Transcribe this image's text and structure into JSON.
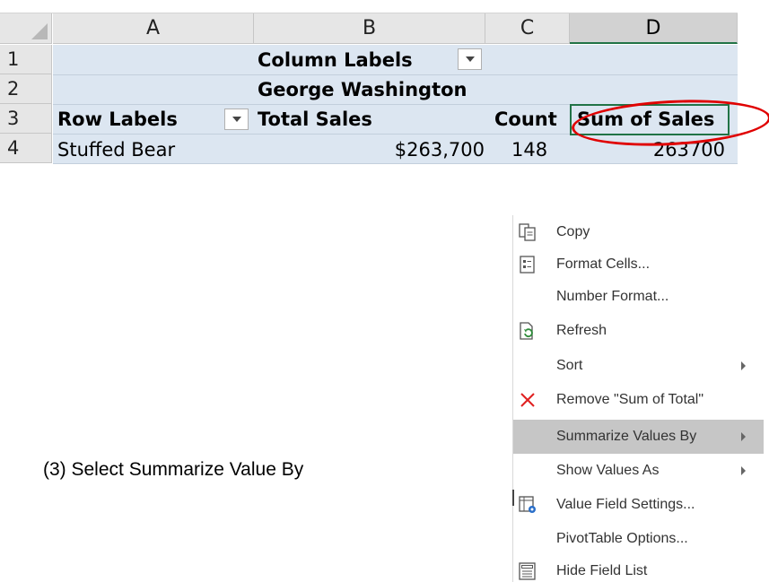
{
  "sheet": {
    "columns": [
      "A",
      "B",
      "C",
      "D"
    ],
    "rows": [
      "1",
      "2",
      "3",
      "4"
    ],
    "cells": {
      "column_labels": "Column Labels",
      "george_washington": "George Washington",
      "row_labels": "Row Labels",
      "total_sales": "Total Sales",
      "count": "Count",
      "sum_of_sales": "Sum of Sales",
      "stuffed_bear": "Stuffed Bear",
      "sales_value": "$263,700",
      "count_value": "148",
      "sum_value": "263700"
    },
    "colors": {
      "pivot_fill": "#dce6f1",
      "selection": "#217346",
      "annotation": "#e00000"
    }
  },
  "caption": "(3)  Select Summarize Value By",
  "context_menu": {
    "items": [
      {
        "label": "Copy",
        "icon": "copy-icon",
        "submenu": false,
        "highlighted": false
      },
      {
        "label": "Format Cells...",
        "icon": "format-cells-icon",
        "submenu": false,
        "highlighted": false
      },
      {
        "label": "Number Format...",
        "icon": "",
        "submenu": false,
        "highlighted": false
      },
      {
        "label": "Refresh",
        "icon": "refresh-icon",
        "submenu": false,
        "highlighted": false
      },
      {
        "label": "Sort",
        "icon": "",
        "submenu": true,
        "highlighted": false
      },
      {
        "label": "Remove \"Sum of Total\"",
        "icon": "remove-icon",
        "submenu": false,
        "highlighted": false
      },
      {
        "label": "Summarize Values By",
        "icon": "",
        "submenu": true,
        "highlighted": true
      },
      {
        "label": "Show Values As",
        "icon": "",
        "submenu": true,
        "highlighted": false
      },
      {
        "label": "Value Field Settings...",
        "icon": "value-field-settings-icon",
        "submenu": false,
        "highlighted": false
      },
      {
        "label": "PivotTable Options...",
        "icon": "",
        "submenu": false,
        "highlighted": false
      },
      {
        "label": "Hide Field List",
        "icon": "field-list-icon",
        "submenu": false,
        "highlighted": false
      }
    ]
  }
}
